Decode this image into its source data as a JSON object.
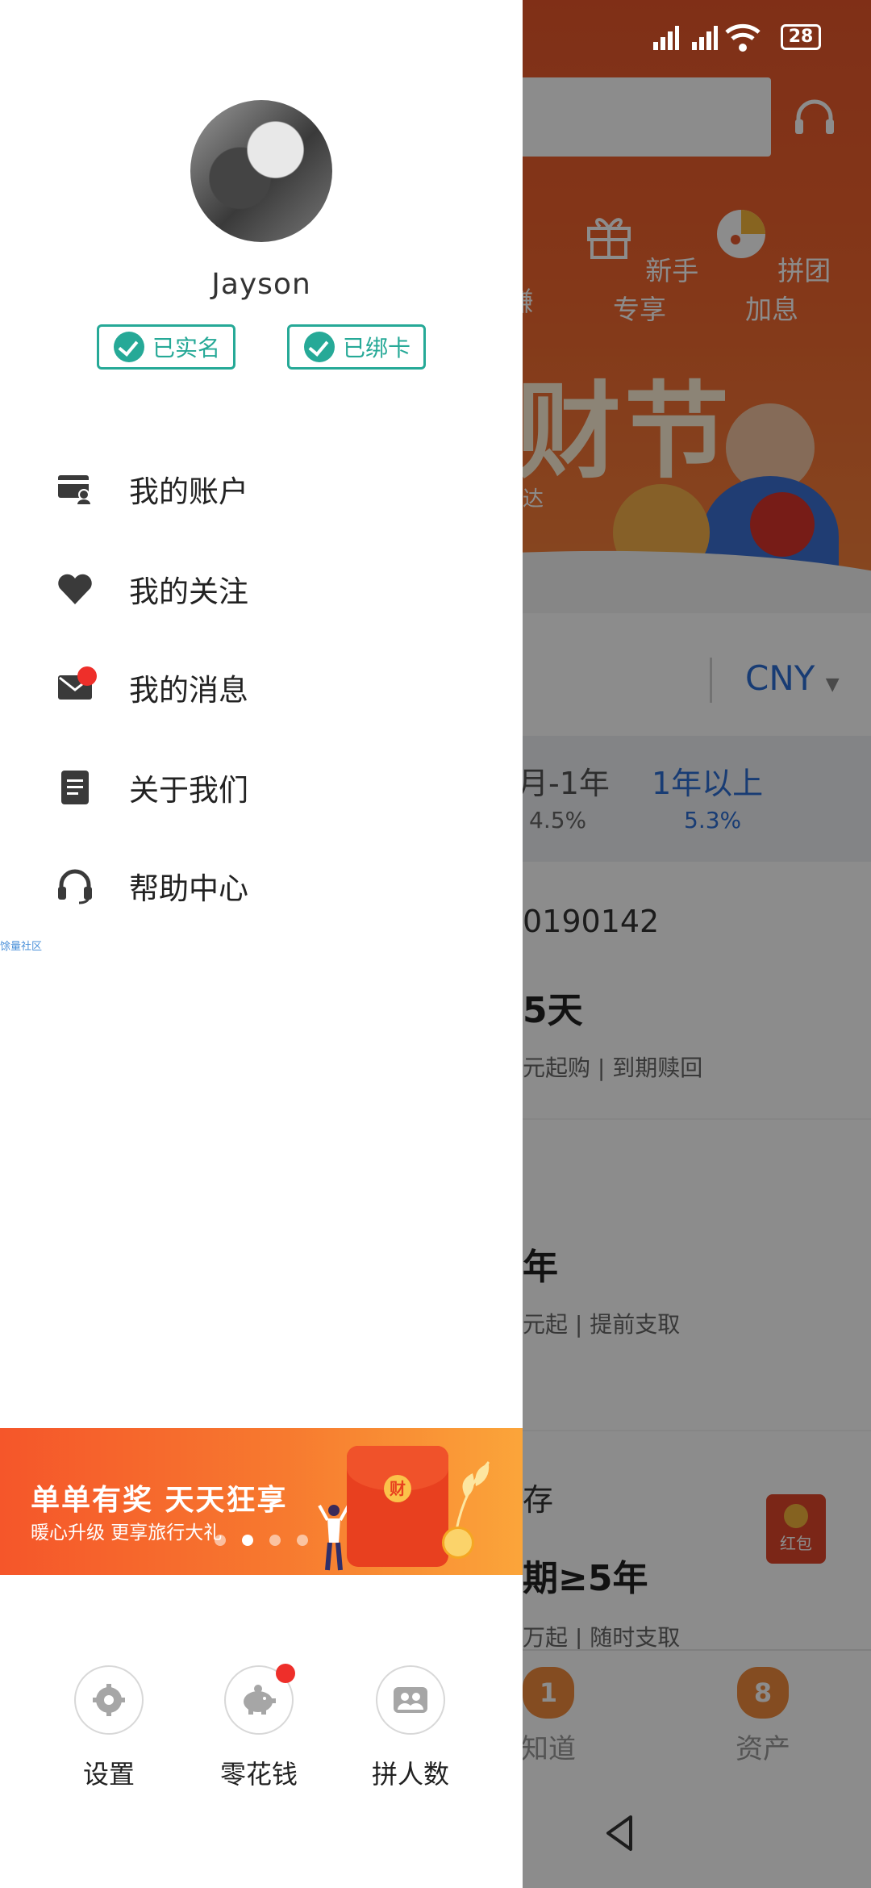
{
  "status_bar": {
    "battery": "28"
  },
  "background": {
    "quick_items": [
      "赚",
      "新手专享",
      "拼团加息"
    ],
    "banner_title": "财节",
    "banner_sub": "达",
    "currency": "CNY",
    "tabs": [
      {
        "label": "月-1年",
        "rate": "4.5%"
      },
      {
        "label": "1年以上",
        "rate": "5.3%"
      }
    ],
    "product1": {
      "code": "0190142",
      "term": "5天",
      "desc": "元起购 | 到期赎回"
    },
    "product2": {
      "term": "年",
      "desc": "元起 | 提前支取"
    },
    "product3": {
      "name": "存",
      "term": "期≥5年",
      "desc": "万起 | 随时支取"
    },
    "hongbao_label": "红包",
    "bottom_nav": [
      {
        "badge": "1",
        "label": "知道"
      },
      {
        "badge": "8",
        "label": "资产"
      }
    ]
  },
  "drawer": {
    "username": "Jayson",
    "badges": [
      "已实名",
      "已绑卡"
    ],
    "menu": [
      {
        "icon": "account-card-icon",
        "label": "我的账户"
      },
      {
        "icon": "heart-icon",
        "label": "我的关注"
      },
      {
        "icon": "mail-icon",
        "label": "我的消息"
      },
      {
        "icon": "document-icon",
        "label": "关于我们"
      },
      {
        "icon": "headset-icon",
        "label": "帮助中心"
      }
    ],
    "tiny_link": "馀量社区",
    "promo": {
      "title": "单单有奖  天天狂享",
      "subtitle": "暖心升级  更享旅行大礼",
      "envelope_char": "财",
      "slide_count": 4,
      "active_slide": 1
    },
    "shortcuts": [
      {
        "icon": "gear-icon",
        "label": "设置"
      },
      {
        "icon": "piggy-bank-icon",
        "label": "零花钱"
      },
      {
        "icon": "group-icon",
        "label": "拼人数"
      }
    ]
  },
  "colors": {
    "accent": "#26a997",
    "brand": "#f0652e",
    "link": "#2c6dd4",
    "notify": "#ee2f2a"
  }
}
